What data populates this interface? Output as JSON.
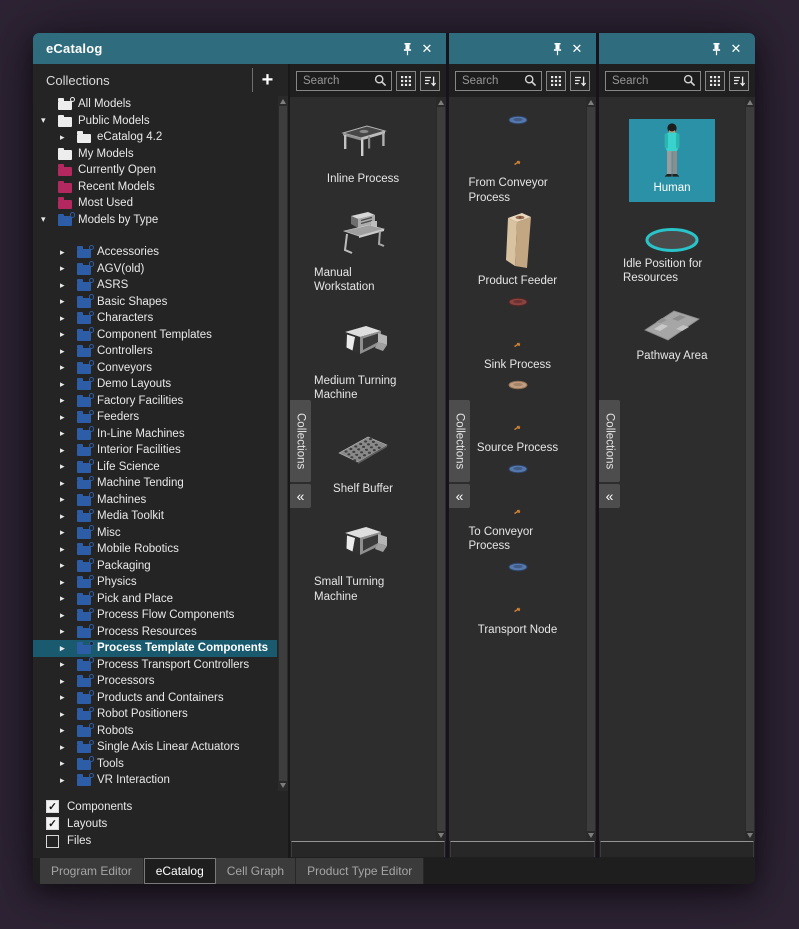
{
  "window": {
    "title": "eCatalog"
  },
  "colors": {
    "page_bg": "#2d2334",
    "gap_bg": "#18121d",
    "window_bg": "#1f1f1f",
    "pane_bg": "#242425",
    "panel_bg": "#2d2d2d",
    "titlebar": "#2e6c7e",
    "selection": "#1a5a6e",
    "selected_tile": "#2b91a6",
    "accent_teal": "#29c3ca",
    "folder_blue": "#2d5da6",
    "folder_pink": "#b3295f",
    "folder_white": "#ededed",
    "disc_blue": "#5578ad",
    "disc_red": "#8a4340",
    "disc_tan": "#c29d80",
    "tick_orange": "#c87f35"
  },
  "collections": {
    "header": "Collections",
    "add_button": "+",
    "tree": [
      {
        "label": "All Models",
        "icon": "white",
        "badge": true,
        "level": 0,
        "arrow": "none"
      },
      {
        "label": "Public Models",
        "icon": "white",
        "level": 0,
        "arrow": "expanded"
      },
      {
        "label": "eCatalog 4.2",
        "icon": "white",
        "level": 1,
        "arrow": "collapsed"
      },
      {
        "label": "My Models",
        "icon": "white",
        "level": 0,
        "arrow": "none"
      },
      {
        "label": "Currently Open",
        "icon": "pink",
        "level": 0,
        "arrow": "none"
      },
      {
        "label": "Recent Models",
        "icon": "pink",
        "level": 0,
        "arrow": "none"
      },
      {
        "label": "Most Used",
        "icon": "pink",
        "level": 0,
        "arrow": "none"
      },
      {
        "label": "Models by Type",
        "icon": "blue",
        "badge": true,
        "level": 0,
        "arrow": "expanded"
      },
      {
        "spacer": true
      },
      {
        "label": "Accessories",
        "icon": "blue",
        "badge": true,
        "level": 1,
        "arrow": "collapsed"
      },
      {
        "label": "AGV(old)",
        "icon": "blue",
        "badge": true,
        "level": 1,
        "arrow": "collapsed"
      },
      {
        "label": "ASRS",
        "icon": "blue",
        "badge": true,
        "level": 1,
        "arrow": "collapsed"
      },
      {
        "label": "Basic Shapes",
        "icon": "blue",
        "badge": true,
        "level": 1,
        "arrow": "collapsed"
      },
      {
        "label": "Characters",
        "icon": "blue",
        "badge": true,
        "level": 1,
        "arrow": "collapsed"
      },
      {
        "label": "Component Templates",
        "icon": "blue",
        "badge": true,
        "level": 1,
        "arrow": "collapsed"
      },
      {
        "label": "Controllers",
        "icon": "blue",
        "badge": true,
        "level": 1,
        "arrow": "collapsed"
      },
      {
        "label": "Conveyors",
        "icon": "blue",
        "badge": true,
        "level": 1,
        "arrow": "collapsed"
      },
      {
        "label": "Demo Layouts",
        "icon": "blue",
        "badge": true,
        "level": 1,
        "arrow": "collapsed"
      },
      {
        "label": "Factory Facilities",
        "icon": "blue",
        "badge": true,
        "level": 1,
        "arrow": "collapsed"
      },
      {
        "label": "Feeders",
        "icon": "blue",
        "badge": true,
        "level": 1,
        "arrow": "collapsed"
      },
      {
        "label": "In-Line Machines",
        "icon": "blue",
        "badge": true,
        "level": 1,
        "arrow": "collapsed"
      },
      {
        "label": "Interior Facilities",
        "icon": "blue",
        "badge": true,
        "level": 1,
        "arrow": "collapsed"
      },
      {
        "label": "Life Science",
        "icon": "blue",
        "badge": true,
        "level": 1,
        "arrow": "collapsed"
      },
      {
        "label": "Machine Tending",
        "icon": "blue",
        "badge": true,
        "level": 1,
        "arrow": "collapsed"
      },
      {
        "label": "Machines",
        "icon": "blue",
        "badge": true,
        "level": 1,
        "arrow": "collapsed"
      },
      {
        "label": "Media Toolkit",
        "icon": "blue",
        "badge": true,
        "level": 1,
        "arrow": "collapsed"
      },
      {
        "label": "Misc",
        "icon": "blue",
        "badge": true,
        "level": 1,
        "arrow": "collapsed"
      },
      {
        "label": "Mobile Robotics",
        "icon": "blue",
        "badge": true,
        "level": 1,
        "arrow": "collapsed"
      },
      {
        "label": "Packaging",
        "icon": "blue",
        "badge": true,
        "level": 1,
        "arrow": "collapsed"
      },
      {
        "label": "Physics",
        "icon": "blue",
        "badge": true,
        "level": 1,
        "arrow": "collapsed"
      },
      {
        "label": "Pick and Place",
        "icon": "blue",
        "badge": true,
        "level": 1,
        "arrow": "collapsed"
      },
      {
        "label": "Process Flow Components",
        "icon": "blue",
        "badge": true,
        "level": 1,
        "arrow": "collapsed"
      },
      {
        "label": "Process Resources",
        "icon": "blue",
        "badge": true,
        "level": 1,
        "arrow": "collapsed"
      },
      {
        "label": "Process Template Components",
        "icon": "blue",
        "badge": true,
        "level": 1,
        "arrow": "collapsed",
        "selected": true
      },
      {
        "label": "Process Transport Controllers",
        "icon": "blue",
        "badge": true,
        "level": 1,
        "arrow": "collapsed"
      },
      {
        "label": "Processors",
        "icon": "blue",
        "badge": true,
        "level": 1,
        "arrow": "collapsed"
      },
      {
        "label": "Products and Containers",
        "icon": "blue",
        "badge": true,
        "level": 1,
        "arrow": "collapsed"
      },
      {
        "label": "Robot Positioners",
        "icon": "blue",
        "badge": true,
        "level": 1,
        "arrow": "collapsed"
      },
      {
        "label": "Robots",
        "icon": "blue",
        "badge": true,
        "level": 1,
        "arrow": "collapsed"
      },
      {
        "label": "Single Axis Linear Actuators",
        "icon": "blue",
        "badge": true,
        "level": 1,
        "arrow": "collapsed"
      },
      {
        "label": "Tools",
        "icon": "blue",
        "badge": true,
        "level": 1,
        "arrow": "collapsed"
      },
      {
        "label": "VR Interaction",
        "icon": "blue",
        "badge": true,
        "level": 1,
        "arrow": "collapsed"
      }
    ],
    "filters": [
      {
        "label": "Components",
        "checked": true
      },
      {
        "label": "Layouts",
        "checked": true
      },
      {
        "label": "Files",
        "checked": false
      }
    ]
  },
  "panels": [
    {
      "search_placeholder": "Search",
      "side_tab": "Collections",
      "items": [
        {
          "label": "Inline Process",
          "icon": "inline-process"
        },
        {
          "label": "Manual Workstation",
          "icon": "manual-workstation"
        },
        {
          "label": "Medium Turning Machine",
          "icon": "turning-machine"
        },
        {
          "label": "Shelf Buffer",
          "icon": "shelf-buffer"
        },
        {
          "label": "Small Turning Machine",
          "icon": "turning-machine"
        }
      ]
    },
    {
      "search_placeholder": "Search",
      "side_tab": "Collections",
      "items": [
        {
          "label": "From Conveyor Process",
          "icon": "disc-blue"
        },
        {
          "label": "Product Feeder",
          "icon": "product-feeder"
        },
        {
          "label": "Sink Process",
          "icon": "disc-red"
        },
        {
          "label": "Source Process",
          "icon": "disc-tan"
        },
        {
          "label": "To Conveyor Process",
          "icon": "disc-blue"
        },
        {
          "label": "Transport Node",
          "icon": "disc-blue"
        }
      ]
    },
    {
      "search_placeholder": "Search",
      "side_tab": "Collections",
      "items": [
        {
          "label": "Human",
          "icon": "human",
          "selected": true
        },
        {
          "label": "Idle Position for Resources",
          "icon": "idle-ring"
        },
        {
          "label": "Pathway Area",
          "icon": "pathway-area"
        }
      ]
    }
  ],
  "bottom_tabs": [
    {
      "label": "Program Editor",
      "active": false
    },
    {
      "label": "eCatalog",
      "active": true
    },
    {
      "label": "Cell Graph",
      "active": false
    },
    {
      "label": "Product Type Editor",
      "active": false
    }
  ]
}
